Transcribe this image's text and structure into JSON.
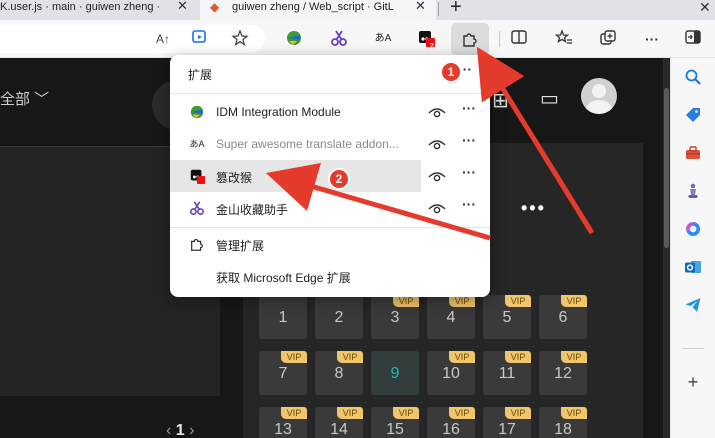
{
  "tabs": [
    {
      "title": "K.user.js · main · guiwen zheng ·"
    },
    {
      "title": "guiwen zheng / Web_script · GitL"
    }
  ],
  "toolbar": {
    "read_aloud": "A↑",
    "ext_tm_badge": "2"
  },
  "popup": {
    "title": "扩展",
    "items": [
      {
        "label": "IDM Integration Module"
      },
      {
        "label": "Super awesome translate addon..."
      },
      {
        "label": "篡改猴"
      },
      {
        "label": "金山收藏助手"
      }
    ],
    "manage": "管理扩展",
    "get": "获取 Microsoft Edge 扩展"
  },
  "page": {
    "left_fragment": "全部",
    "pagination": "1"
  },
  "episodes": [
    {
      "n": "1",
      "vip": ""
    },
    {
      "n": "2",
      "vip": ""
    },
    {
      "n": "3",
      "vip": "VIP"
    },
    {
      "n": "4",
      "vip": "VIP"
    },
    {
      "n": "5",
      "vip": "VIP"
    },
    {
      "n": "6",
      "vip": "VIP"
    },
    {
      "n": "7",
      "vip": "VIP"
    },
    {
      "n": "8",
      "vip": "VIP"
    },
    {
      "n": "9",
      "vip": "",
      "current": true
    },
    {
      "n": "10",
      "vip": "VIP"
    },
    {
      "n": "11",
      "vip": "VIP"
    },
    {
      "n": "12",
      "vip": "VIP"
    },
    {
      "n": "13",
      "vip": "VIP"
    },
    {
      "n": "14",
      "vip": "VIP"
    },
    {
      "n": "15",
      "vip": "VIP"
    },
    {
      "n": "16",
      "vip": "VIP"
    },
    {
      "n": "17",
      "vip": "VIP"
    },
    {
      "n": "18",
      "vip": "VIP"
    }
  ],
  "annotations": {
    "step1": "1",
    "step2": "2"
  },
  "colors": {
    "arrow": "#e53b2c",
    "vip": "#f0c66b",
    "current_episode": "#19b8b8"
  }
}
